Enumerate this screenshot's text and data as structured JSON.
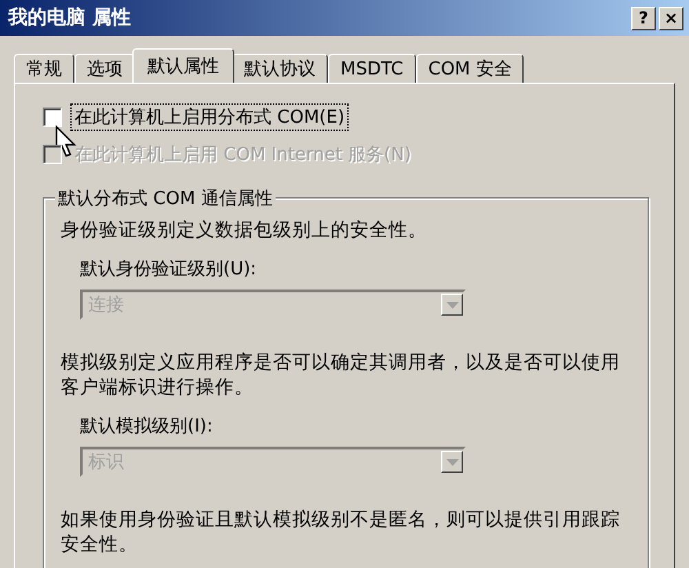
{
  "window": {
    "title": "我的电脑 属性",
    "buttons": [
      {
        "kind": "help",
        "label": "?"
      },
      {
        "kind": "close",
        "label": "×"
      }
    ]
  },
  "tabs": [
    {
      "label": "常规",
      "selected": false
    },
    {
      "label": "选项",
      "selected": false
    },
    {
      "label": "默认属性",
      "selected": true
    },
    {
      "label": "默认协议",
      "selected": false
    },
    {
      "label": "MSDTC",
      "selected": false
    },
    {
      "label": "COM 安全",
      "selected": false
    }
  ],
  "checkboxes": [
    {
      "label": "在此计算机上启用分布式 COM(E)",
      "checked": false,
      "disabled": false,
      "focused": true
    },
    {
      "label": "在此计算机上启用 COM Internet 服务(N)",
      "checked": false,
      "disabled": true,
      "focused": false
    }
  ],
  "group": {
    "title": "默认分布式 COM 通信属性",
    "sections": [
      {
        "description": "身份验证级别定义数据包级别上的安全性。",
        "label": "默认身份验证级别(U):",
        "dropdown": {
          "value": "连接",
          "disabled": true
        }
      },
      {
        "description": "模拟级别定义应用程序是否可以确定其调用者，以及是否可以使用客户端标识进行操作。",
        "label": "默认模拟级别(I):",
        "dropdown": {
          "value": "标识",
          "disabled": true
        }
      }
    ],
    "note": "如果使用身份验证且默认模拟级别不是匿名，则可以提供引用跟踪安全性。"
  }
}
